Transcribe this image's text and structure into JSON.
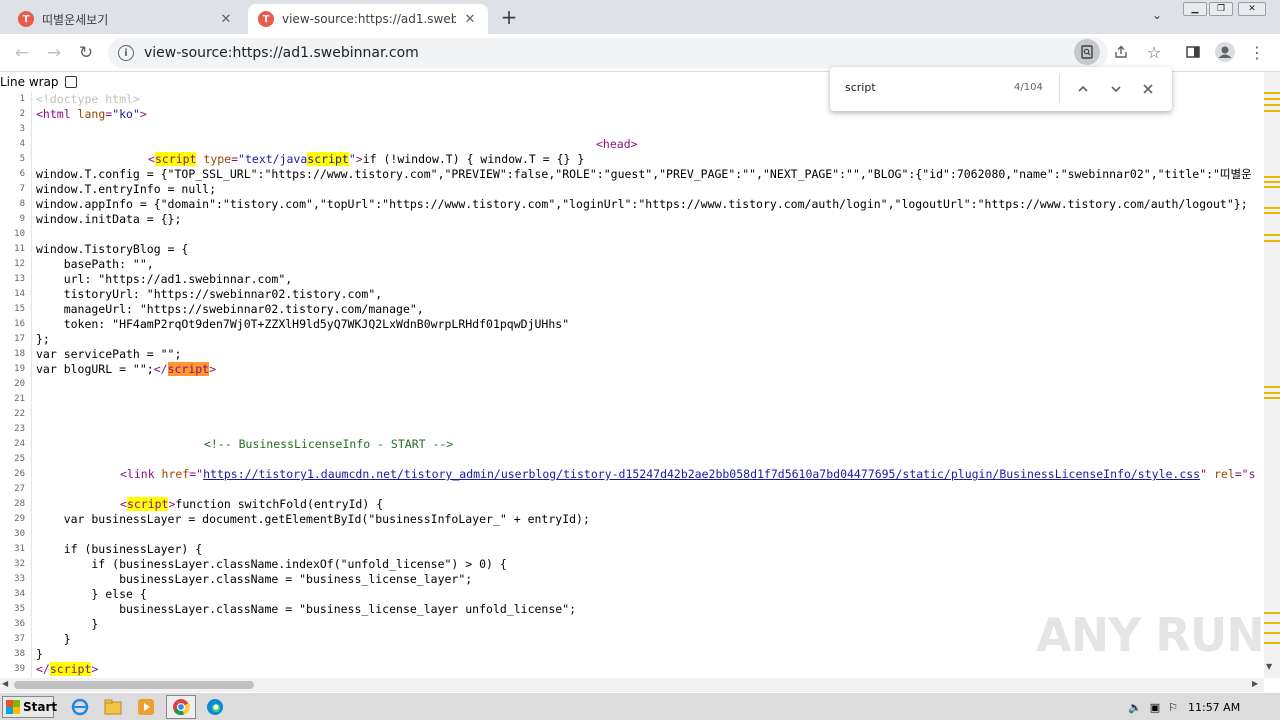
{
  "tabs": [
    {
      "title": "띠별운세보기",
      "active": false
    },
    {
      "title": "view-source:https://ad1.swebinnar.com",
      "active": true
    }
  ],
  "toolbar": {
    "url": "view-source:https://ad1.swebinnar.com"
  },
  "page": {
    "line_wrap_label": "Line wrap"
  },
  "find": {
    "query": "script",
    "count": "4/104"
  },
  "source_lines": [
    {
      "n": "1"
    },
    {
      "n": "2"
    },
    {
      "n": "3"
    },
    {
      "n": "4"
    },
    {
      "n": "5"
    },
    {
      "n": "6"
    },
    {
      "n": "7"
    },
    {
      "n": "8"
    },
    {
      "n": "9"
    },
    {
      "n": "10"
    },
    {
      "n": "11"
    },
    {
      "n": "12"
    },
    {
      "n": "13"
    },
    {
      "n": "14"
    },
    {
      "n": "15"
    },
    {
      "n": "16"
    },
    {
      "n": "17"
    },
    {
      "n": "18"
    },
    {
      "n": "19"
    },
    {
      "n": "20"
    },
    {
      "n": "21"
    },
    {
      "n": "22"
    },
    {
      "n": "23"
    },
    {
      "n": "24"
    },
    {
      "n": "25"
    },
    {
      "n": "26"
    },
    {
      "n": "27"
    },
    {
      "n": "28"
    },
    {
      "n": "29"
    },
    {
      "n": "30"
    },
    {
      "n": "31"
    },
    {
      "n": "32"
    },
    {
      "n": "33"
    },
    {
      "n": "34"
    },
    {
      "n": "35"
    },
    {
      "n": "36"
    },
    {
      "n": "37"
    },
    {
      "n": "38"
    },
    {
      "n": "39"
    }
  ],
  "code": {
    "l1": "<!doctype html>",
    "l2_open": "<html ",
    "l2_attr": "lang",
    "l2_eq": "=",
    "l2_val": "\"ko\"",
    "l2_close": ">",
    "l4": "<head>",
    "l5_lt": "<",
    "l5_script": "script",
    "l5_attr": " type",
    "l5_eq": "=",
    "l5_val1": "\"text/java",
    "l5_val2": "script",
    "l5_val3": "\"",
    "l5_gt": ">",
    "l5_text": "if (!window.T) { window.T = {} }",
    "l6": "window.T.config = {\"TOP_SSL_URL\":\"https://www.tistory.com\",\"PREVIEW\":false,\"ROLE\":\"guest\",\"PREV_PAGE\":\"\",\"NEXT_PAGE\":\"\",\"BLOG\":{\"id\":7062080,\"name\":\"swebinnar02\",\"title\":\"띠별운",
    "l7": "window.T.entryInfo = null;",
    "l8": "window.appInfo = {\"domain\":\"tistory.com\",\"topUrl\":\"https://www.tistory.com\",\"loginUrl\":\"https://www.tistory.com/auth/login\",\"logoutUrl\":\"https://www.tistory.com/auth/logout\"};",
    "l9": "window.initData = {};",
    "l11": "window.TistoryBlog = {",
    "l12": "    basePath: \"\",",
    "l13": "    url: \"https://ad1.swebinnar.com\",",
    "l14": "    tistoryUrl: \"https://swebinnar02.tistory.com\",",
    "l15": "    manageUrl: \"https://swebinnar02.tistory.com/manage\",",
    "l16": "    token: \"HF4amP2rqOt9den7Wj0T+ZZXlH9ld5yQ7WKJQ2LxWdnB0wrpLRHdf01pqwDjUHhs\"",
    "l17": "};",
    "l18": "var servicePath = \"\";",
    "l19_text": "var blogURL = \"\";",
    "l19_lt": "</",
    "l19_script": "script",
    "l19_gt": ">",
    "l24": "<!-- BusinessLicenseInfo - START -->",
    "l26_open": "<link ",
    "l26_attr": "href",
    "l26_eq": "=\"",
    "l26_link": "https://tistory1.daumcdn.net/tistory_admin/userblog/tistory-d15247d42b2ae2bb058d1f7d5610a7bd04477695/static/plugin/BusinessLicenseInfo/style.css",
    "l26_q": "\"",
    "l26_rel": " rel",
    "l26_rest": "=\"s",
    "l28_lt": "<",
    "l28_script": "script",
    "l28_gt": ">",
    "l28_text": "function switchFold(entryId) {",
    "l29": "    var businessLayer = document.getElementById(\"businessInfoLayer_\" + entryId);",
    "l31": "    if (businessLayer) {",
    "l32": "        if (businessLayer.className.indexOf(\"unfold_license\") > 0) {",
    "l33": "            businessLayer.className = \"business_license_layer\";",
    "l34": "        } else {",
    "l35": "            businessLayer.className = \"business_license_layer unfold_license\";",
    "l36": "        }",
    "l37": "    }",
    "l38": "}",
    "l39_lt": "</",
    "l39_script": "script",
    "l39_gt": ">"
  },
  "watermark": "ANY RUN",
  "taskbar": {
    "start_label": "Start",
    "clock": "11:57 AM"
  },
  "colors": {
    "highlight": "#ffff00",
    "active_highlight": "#ff9632",
    "tag": "#881280",
    "attr": "#994500",
    "value": "#1a1aa6",
    "comment": "#236e25"
  }
}
